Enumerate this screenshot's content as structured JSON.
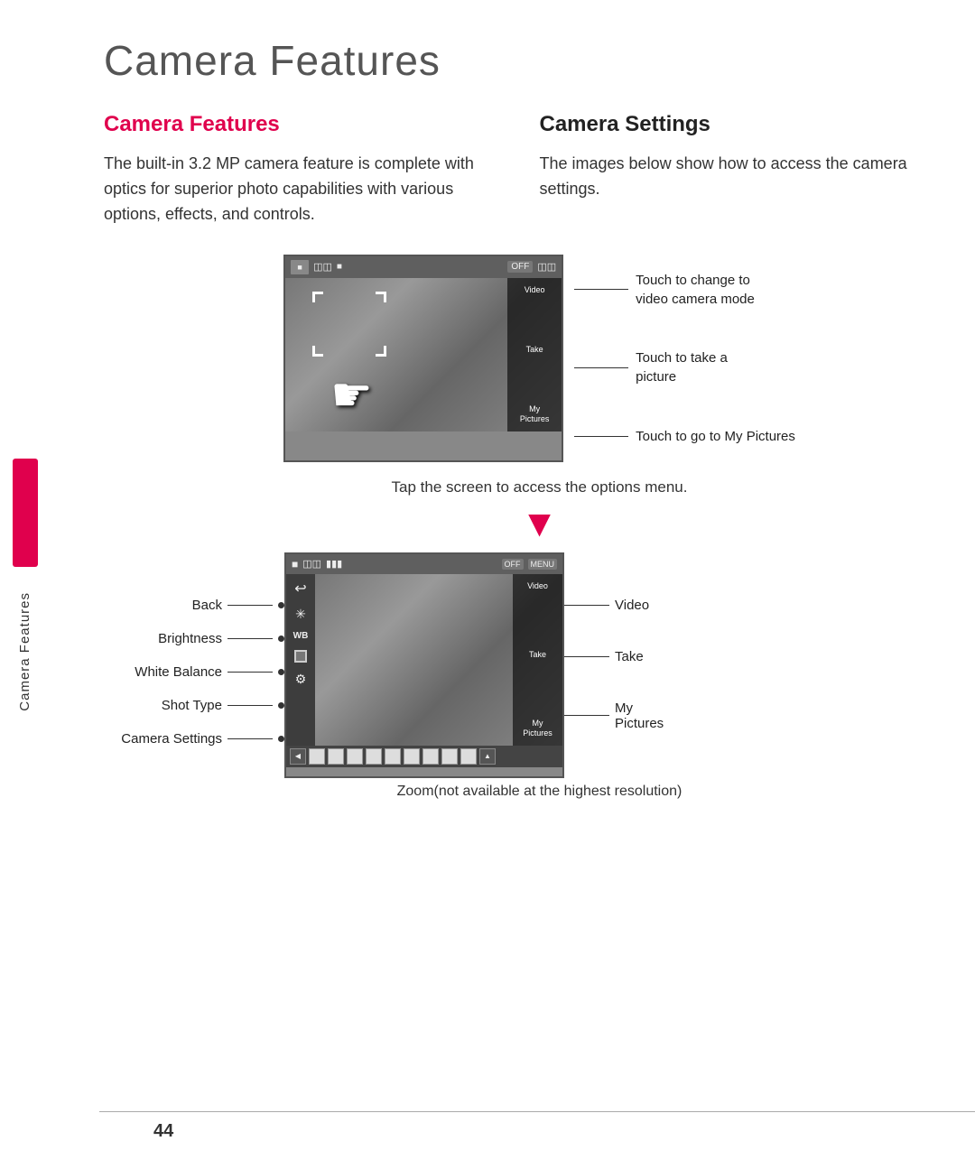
{
  "page": {
    "title": "Camera Features",
    "page_number": "44"
  },
  "sidebar": {
    "label": "Camera Features"
  },
  "left_section": {
    "heading": "Camera Features",
    "body": "The built-in 3.2 MP camera feature is complete with optics for superior photo capabilities with various options, effects, and controls."
  },
  "right_section": {
    "heading": "Camera Settings",
    "body": "The images below show how to access the camera settings."
  },
  "camera1": {
    "labels": [
      {
        "text": "Touch to change to\nvideo camera mode",
        "button": "Video"
      },
      {
        "text": "Touch to take a\npicture",
        "button": "Take"
      },
      {
        "text": "Touch to go to\nMy Pictures",
        "button": "My\nPictures"
      }
    ]
  },
  "tap_text": "Tap the screen to access the options menu.",
  "camera2": {
    "left_labels": [
      {
        "text": "Back"
      },
      {
        "text": "Brightness"
      },
      {
        "text": "White Balance"
      },
      {
        "text": "Shot Type"
      },
      {
        "text": "Camera Settings"
      }
    ],
    "right_labels": [
      {
        "text": "Video"
      },
      {
        "text": "Take"
      },
      {
        "text": "My\nPictures"
      }
    ]
  },
  "zoom_text": "Zoom(not available at the highest resolution)"
}
